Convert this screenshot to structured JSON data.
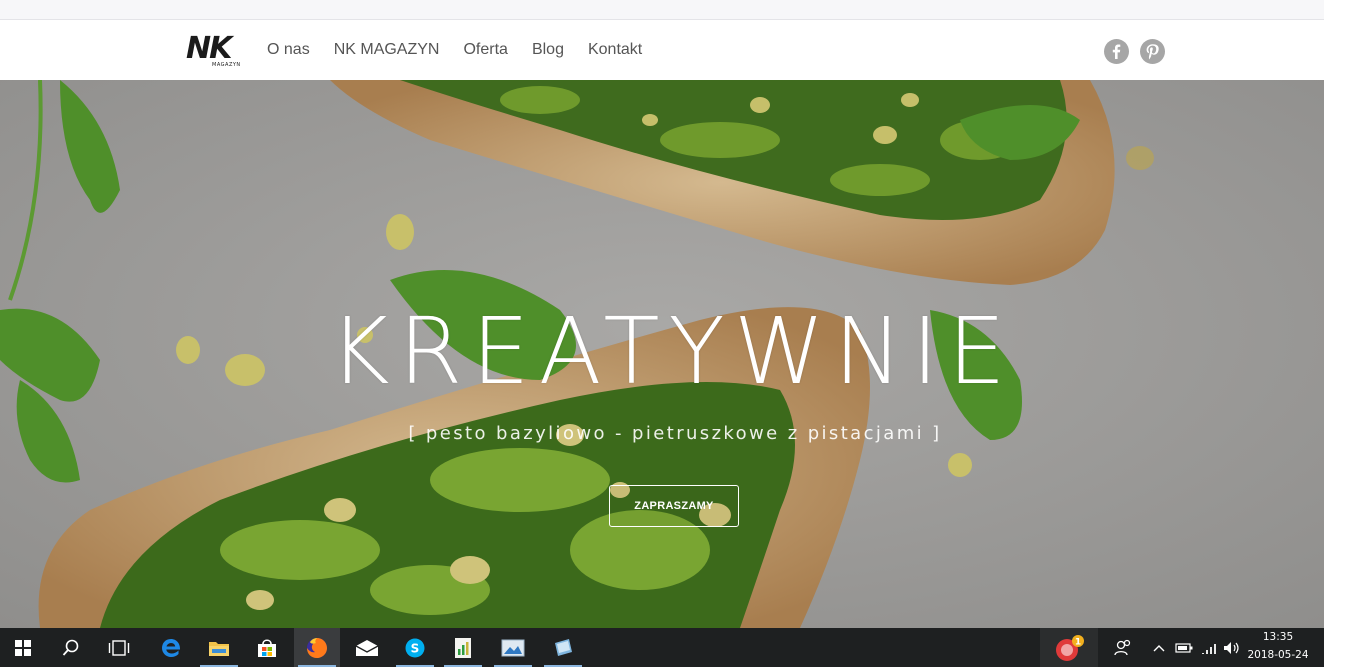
{
  "brand": {
    "logo_text": "NK",
    "logo_sub": "MAGAZYN"
  },
  "nav": {
    "items": [
      {
        "label": "O nas"
      },
      {
        "label": "NK MAGAZYN"
      },
      {
        "label": "Oferta"
      },
      {
        "label": "Blog"
      },
      {
        "label": "Kontakt"
      }
    ]
  },
  "social": {
    "icons": [
      "facebook-icon",
      "pinterest-icon"
    ],
    "color": "#a6a6a6"
  },
  "hero": {
    "title": "KREATYWNIE",
    "subtitle": "[ pesto bazyliowo - pietruszkowe z pistacjami ]",
    "button_label": "ZAPRASZAMY"
  },
  "taskbar": {
    "apps": [
      "windows-start-icon",
      "search-icon",
      "task-view-icon",
      "edge-icon",
      "file-explorer-icon",
      "store-icon",
      "firefox-icon",
      "mail-icon",
      "skype-icon",
      "spreadsheet-icon",
      "photos-icon",
      "notepad-icon"
    ],
    "notification_badge": "1",
    "clock": {
      "time": "13:35",
      "date": "2018-05-24"
    },
    "background": "#1e2021"
  }
}
